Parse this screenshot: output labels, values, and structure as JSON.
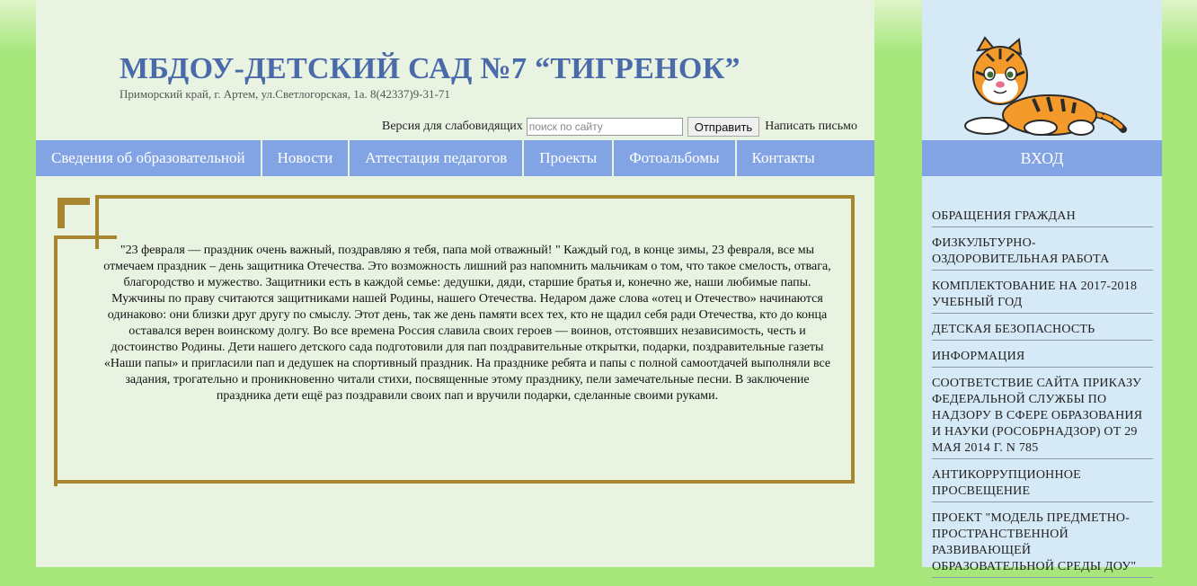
{
  "header": {
    "title": "МБДОУ-ДЕТСКИЙ САД №7 “ТИГРЕНОК”",
    "address": "Приморский край, г. Артем, ул.Светлогорская, 1а. 8(42337)9-31-71"
  },
  "toolbar": {
    "visually_impaired_label": "Версия для слабовидящих",
    "search_placeholder": "поиск по сайту",
    "submit_label": "Отправить",
    "write_letter_label": "Написать письмо"
  },
  "nav": {
    "items": [
      {
        "label": "Сведения об образовательной"
      },
      {
        "label": "Новости"
      },
      {
        "label": "Аттестация педагогов"
      },
      {
        "label": "Проекты"
      },
      {
        "label": "Фотоальбомы"
      },
      {
        "label": "Контакты"
      }
    ]
  },
  "article": {
    "text": "\"23 февраля — праздник очень важный, поздравляю я тебя, папа мой отважный! \" Каждый год, в конце зимы, 23 февраля, все мы отмечаем праздник – день защитника Отечества. Это возможность лишний раз напомнить мальчикам о том, что такое смелость, отвага, благородство и мужество. Защитники есть в каждой семье: дедушки, дяди, старшие братья и, конечно же, наши любимые папы. Мужчины по праву считаются защитниками нашей Родины, нашего Отечества. Недаром даже слова «отец и Отечество» начинаются одинаково: они близки друг другу по смыслу. Этот день, так же день памяти всех тех, кто не щадил себя ради Отечества, кто до конца оставался верен воинскому долгу. Во все времена Россия славила своих героев — воинов, отстоявших независимость, честь и достоинство Родины. Дети нашего детского сада подготовили для пап поздравительные открытки, подарки, поздравительные газеты «Наши папы» и пригласили пап и дедушек на спортивный праздник. На празднике ребята и папы с полной самоотдачей выполняли все задания, трогательно и проникновенно читали стихи, посвященные этому празднику, пели замечательные песни. В заключение праздника дети ещё раз поздравили своих пап и вручили подарки, сделанные своими руками."
  },
  "sidebar": {
    "login_label": "ВХОД",
    "logo_icon": "tiger-cub-icon",
    "items": [
      {
        "label": "ОБРАЩЕНИЯ ГРАЖДАН"
      },
      {
        "label": "ФИЗКУЛЬТУРНО-ОЗДОРОВИТЕЛЬНАЯ РАБОТА"
      },
      {
        "label": "КОМПЛЕКТОВАНИЕ НА 2017-2018 УЧЕБНЫЙ ГОД"
      },
      {
        "label": "ДЕТСКАЯ БЕЗОПАСНОСТЬ"
      },
      {
        "label": "ИНФОРМАЦИЯ"
      },
      {
        "label": "СООТВЕТСТВИЕ САЙТА ПРИКАЗУ ФЕДЕРАЛЬНОЙ СЛУЖБЫ ПО НАДЗОРУ В СФЕРЕ ОБРАЗОВАНИЯ И НАУКИ (РОСОБРНАДЗОР) ОТ 29 МАЯ 2014 Г. N 785"
      },
      {
        "label": "АНТИКОРРУПЦИОННОЕ ПРОСВЕЩЕНИЕ"
      },
      {
        "label": "ПРОЕКТ \"МОДЕЛЬ ПРЕДМЕТНО-ПРОСТРАНСТВЕННОЙ РАЗВИВАЮЩЕЙ ОБРАЗОВАТЕЛЬНОЙ СРЕДЫ ДОУ\""
      }
    ]
  },
  "colors": {
    "page_background": "#a6e67b",
    "main_background": "#e8f3e2",
    "sidebar_background": "#d6e9f6",
    "nav_background": "#82a4e4",
    "title_color": "#4a6aaa",
    "frame_color": "#a88530"
  }
}
